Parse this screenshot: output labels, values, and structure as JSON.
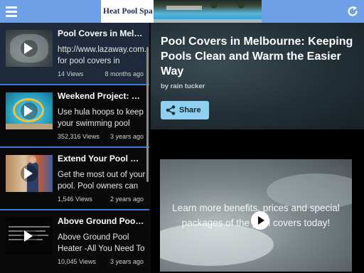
{
  "header": {
    "menu_icon": "hamburger-menu-icon",
    "refresh_icon": "refresh-icon",
    "banner_text": "Heat Pool Spa"
  },
  "sidebar": {
    "items": [
      {
        "title": "Pool Covers in Melb…",
        "description": "http://www.lazaway.com.a for pool covers in",
        "views": "14 Views",
        "age": "8 months ago"
      },
      {
        "title": "Weekend Project: Li…",
        "description": "Use hula hoops to keep your swimming pool",
        "views": "352,316 Views",
        "age": "3 years ago"
      },
      {
        "title": "Extend Your Pool S…",
        "description": "Get the most out of your pool. Pool owners can",
        "views": "1,546 Views",
        "age": "2 years ago"
      },
      {
        "title": "Above Ground Pool …",
        "description": "Above Ground Pool Heater -All You Need To",
        "views": "10,045 Views",
        "age": "3 years ago"
      }
    ]
  },
  "main": {
    "title": "Pool Covers in Melbourne: Keeping Pools Clean and Warm the Easier Way",
    "author": "by rain tucker",
    "share_label": "Share",
    "share_icon": "share-icon",
    "video_text": "Learn more benefits, prices and special packages of the pool covers today!"
  },
  "colors": {
    "topbar": "#6f9fe6",
    "separator": "#3e7ad8",
    "share_button": "#8fd0f0"
  }
}
